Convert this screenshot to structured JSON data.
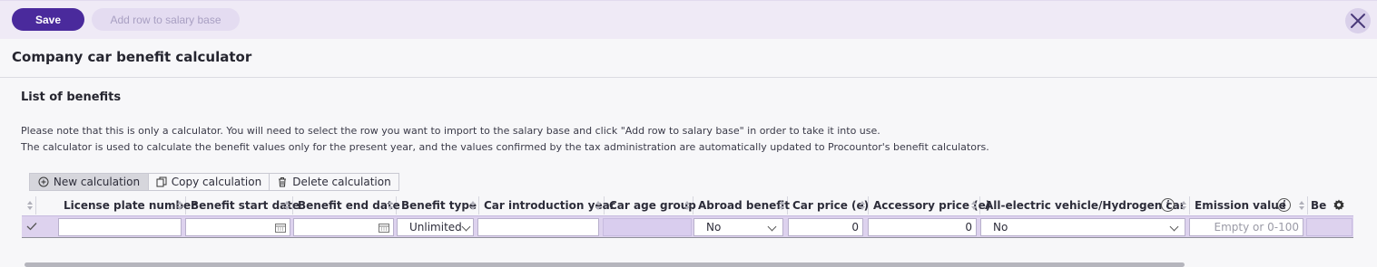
{
  "topbar": {
    "save_label": "Save",
    "add_row_label": "Add row to salary base"
  },
  "page": {
    "title": "Company car benefit calculator"
  },
  "section": {
    "title": "List of benefits",
    "note_line1": "Please note that this is only a calculator. You will need to select the row you want to import to the salary base and click \"Add row to salary base\" in order to take it into use.",
    "note_line2": "The calculator is used to calculate the benefit values only for the present year, and the values confirmed by the tax administration are automatically updated to Procountor's benefit calculators."
  },
  "toolbar": {
    "new_label": "New calculation",
    "copy_label": "Copy calculation",
    "delete_label": "Delete calculation"
  },
  "grid": {
    "columns": [
      "License plate number",
      "Benefit start date",
      "Benefit end date",
      "Benefit type",
      "Car introduction year",
      "Car age group",
      "Abroad benefit",
      "Car price (e)",
      "Accessory price (e)",
      "All-electric vehicle/Hydrogen car",
      "Emission value",
      "Be"
    ],
    "row": {
      "license_plate": "",
      "start_date": "",
      "end_date": "",
      "benefit_type": "Unlimited",
      "introduction_year": "",
      "age_group": "",
      "abroad_benefit": "No",
      "car_price": "0",
      "accessory_price": "0",
      "electric": "No",
      "emission_placeholder": "Empty or 0-100"
    }
  },
  "colors": {
    "accent": "#4a2a9c",
    "row_selected": "#ddd2ee",
    "topbar_bg": "#efeaf6"
  }
}
